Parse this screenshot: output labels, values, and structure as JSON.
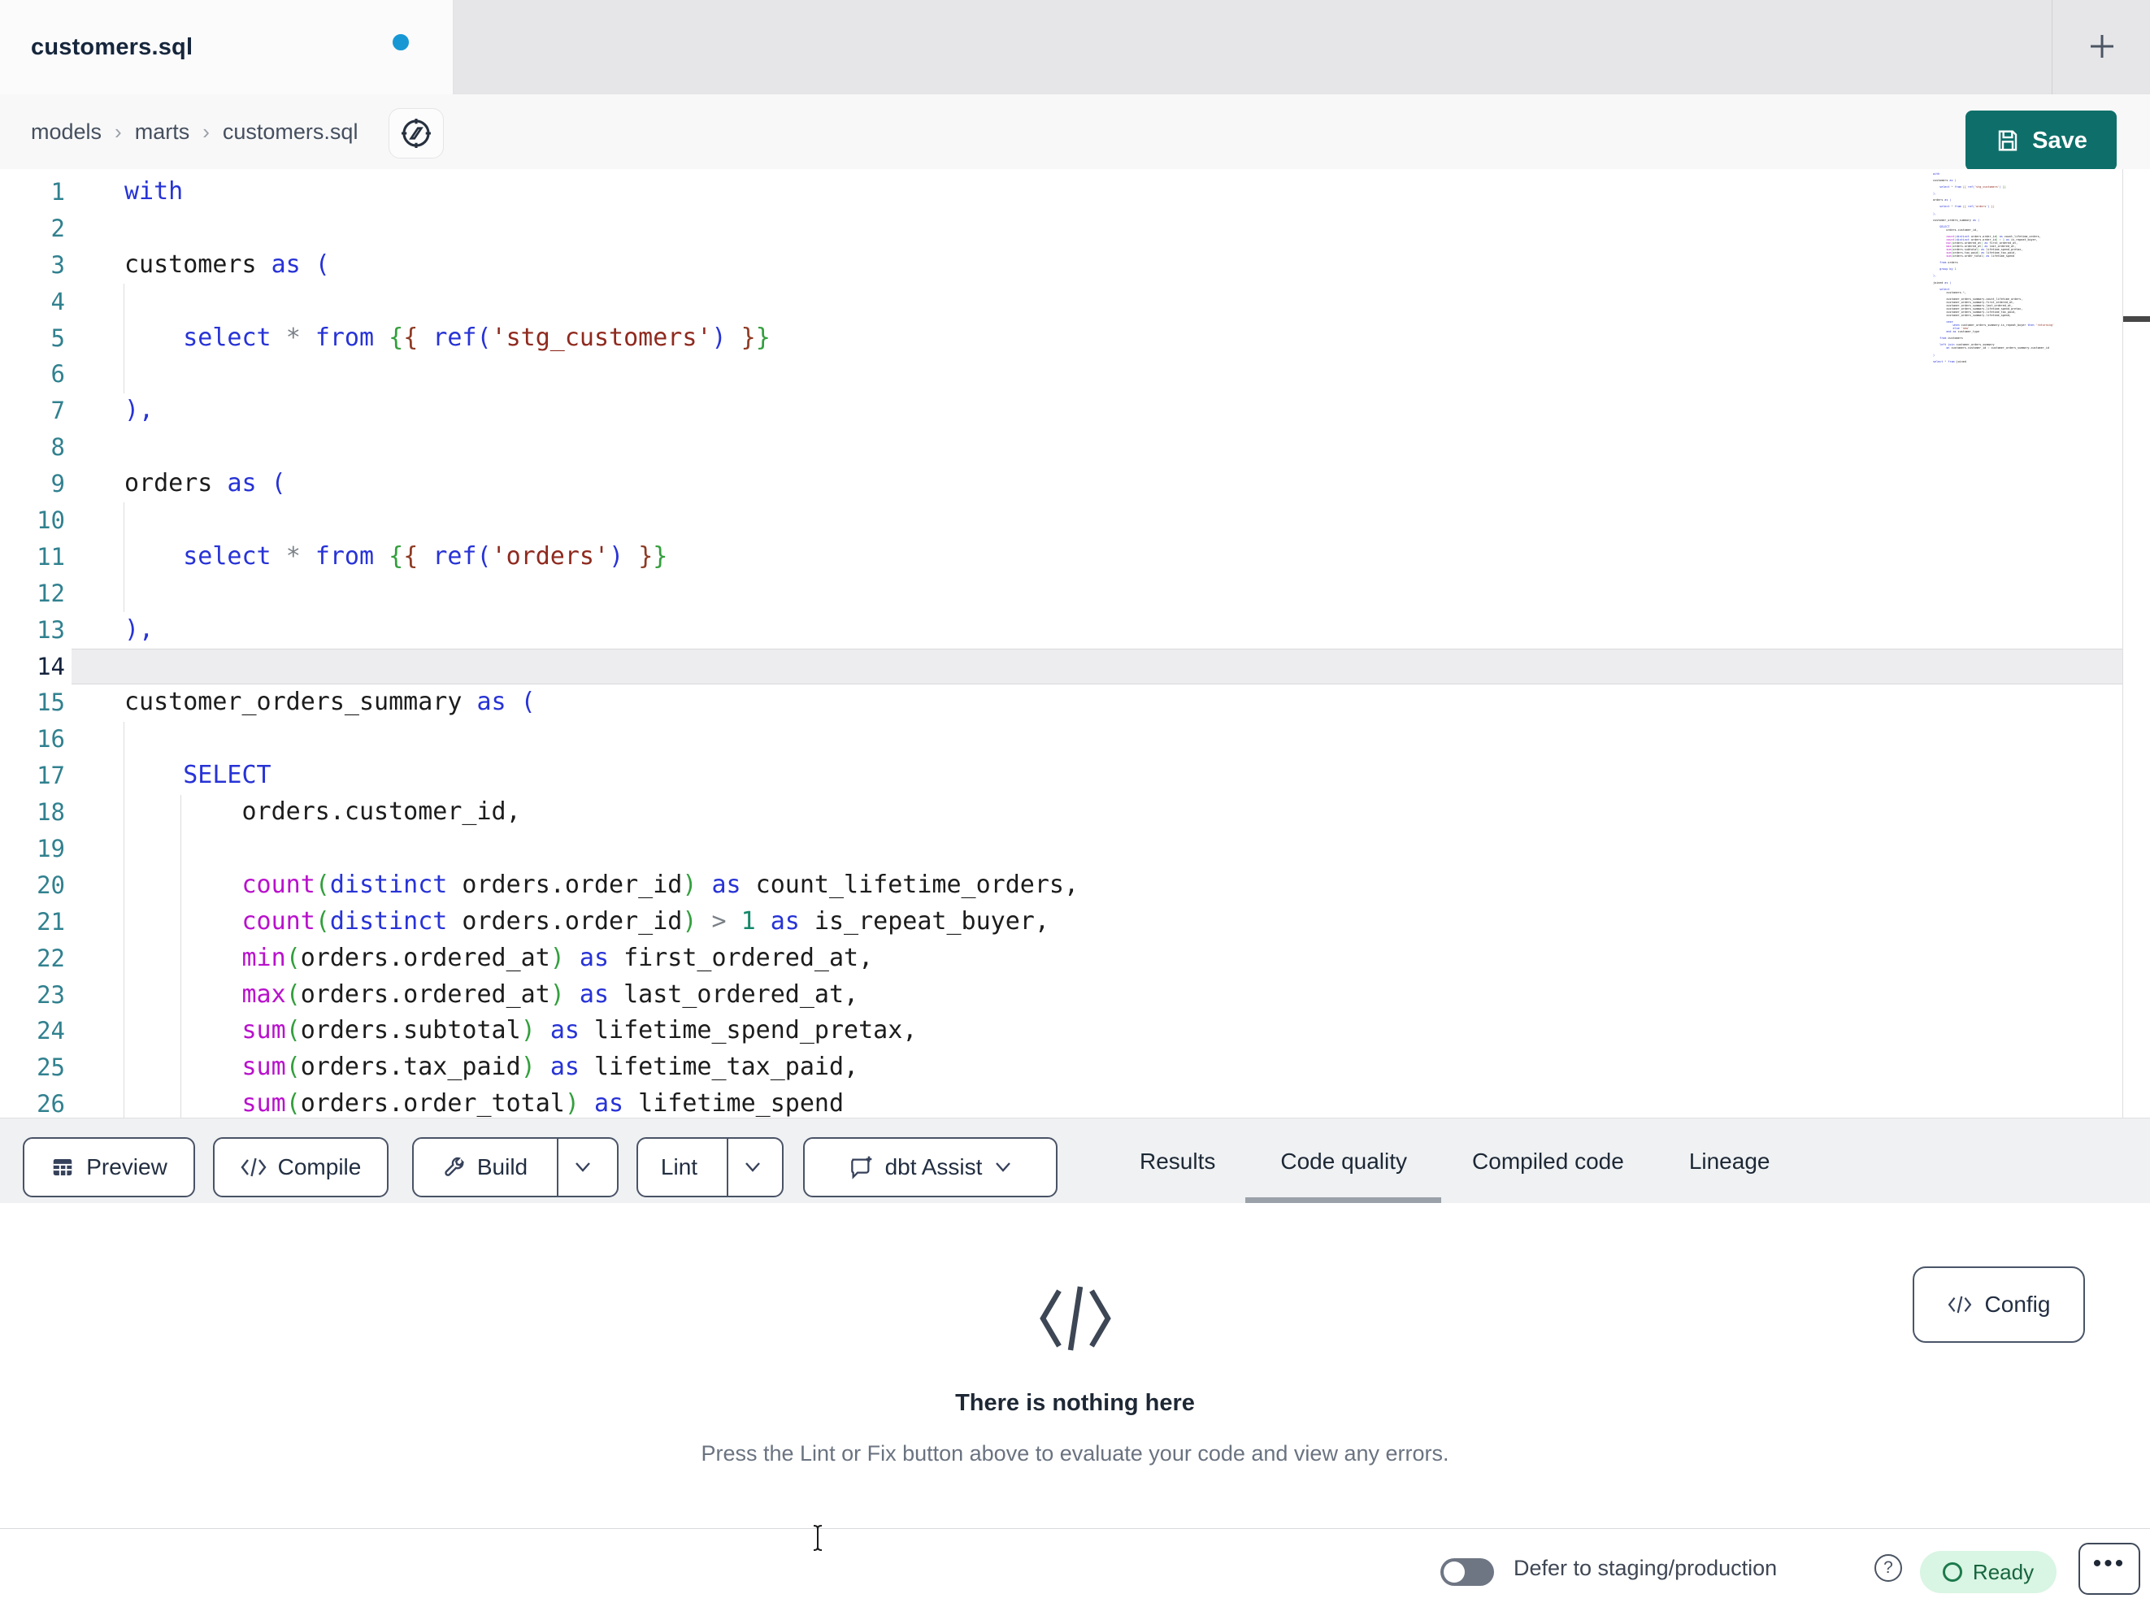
{
  "tab_bar": {
    "tab_title": "customers.sql",
    "unsaved_indicator": "unsaved-changes",
    "new_tab_label": "+"
  },
  "breadcrumb": {
    "items": [
      "models",
      "marts",
      "customers.sql"
    ],
    "separator": "›"
  },
  "save": {
    "label": "Save"
  },
  "toolbar": {
    "preview_label": "Preview",
    "compile_label": "Compile",
    "build_label": "Build",
    "lint_label": "Lint",
    "assist_label": "dbt Assist"
  },
  "tabs": {
    "items": [
      "Results",
      "Code quality",
      "Compiled code",
      "Lineage"
    ],
    "active": "Code quality"
  },
  "panel": {
    "config_label": "Config",
    "empty_title": "There is nothing here",
    "empty_subtitle": "Press the Lint or Fix button above to evaluate your code and view any errors."
  },
  "status_bar": {
    "defer_label": "Defer to staging/production",
    "ready_label": "Ready",
    "more_label": "•••"
  },
  "colors": {
    "accent_save": "#0e6f6a",
    "unsaved_dot": "#1798d5",
    "ready_bg": "#d9f5e3",
    "ready_green": "#1d7a4d",
    "active_tab_underline": "#9ba1a8",
    "line_number": "#31818f",
    "active_line_number": "#15233d",
    "syntax": {
      "k": "#2733d6",
      "f": "#b911cc",
      "s": "#8f2a1f",
      "g": "#339f3d",
      "b": "#8e3b24",
      "n": "#15876a",
      "o": "#7a8087",
      "t": "#1c1c1c"
    }
  },
  "editor": {
    "active_line": 14,
    "lines": [
      {
        "n": 1,
        "t": [
          [
            "k",
            "with"
          ]
        ]
      },
      {
        "n": 2,
        "t": []
      },
      {
        "n": 3,
        "t": [
          [
            "t",
            "customers "
          ],
          [
            "k",
            "as ("
          ]
        ]
      },
      {
        "n": 4,
        "t": []
      },
      {
        "n": 5,
        "t": [
          [
            "t",
            "    "
          ],
          [
            "k",
            "select"
          ],
          [
            "t",
            " "
          ],
          [
            "o",
            "*"
          ],
          [
            "t",
            " "
          ],
          [
            "k",
            "from"
          ],
          [
            "t",
            " "
          ],
          [
            "g",
            "{"
          ],
          [
            "b",
            "{"
          ],
          [
            "t",
            " "
          ],
          [
            "k",
            "ref("
          ],
          [
            "s",
            "'stg_customers'"
          ],
          [
            "k",
            ")"
          ],
          [
            "t",
            " "
          ],
          [
            "b",
            "}"
          ],
          [
            "g",
            "}"
          ]
        ]
      },
      {
        "n": 6,
        "t": []
      },
      {
        "n": 7,
        "t": [
          [
            "k",
            "),"
          ]
        ]
      },
      {
        "n": 8,
        "t": []
      },
      {
        "n": 9,
        "t": [
          [
            "t",
            "orders "
          ],
          [
            "k",
            "as ("
          ]
        ]
      },
      {
        "n": 10,
        "t": []
      },
      {
        "n": 11,
        "t": [
          [
            "t",
            "    "
          ],
          [
            "k",
            "select"
          ],
          [
            "t",
            " "
          ],
          [
            "o",
            "*"
          ],
          [
            "t",
            " "
          ],
          [
            "k",
            "from"
          ],
          [
            "t",
            " "
          ],
          [
            "g",
            "{"
          ],
          [
            "b",
            "{"
          ],
          [
            "t",
            " "
          ],
          [
            "k",
            "ref("
          ],
          [
            "s",
            "'orders'"
          ],
          [
            "k",
            ")"
          ],
          [
            "t",
            " "
          ],
          [
            "b",
            "}"
          ],
          [
            "g",
            "}"
          ]
        ]
      },
      {
        "n": 12,
        "t": []
      },
      {
        "n": 13,
        "t": [
          [
            "k",
            "),"
          ]
        ]
      },
      {
        "n": 14,
        "t": []
      },
      {
        "n": 15,
        "t": [
          [
            "t",
            "customer_orders_summary "
          ],
          [
            "k",
            "as ("
          ]
        ]
      },
      {
        "n": 16,
        "t": []
      },
      {
        "n": 17,
        "t": [
          [
            "t",
            "    "
          ],
          [
            "k",
            "SELECT"
          ]
        ]
      },
      {
        "n": 18,
        "t": [
          [
            "t",
            "        orders.customer_id,"
          ]
        ]
      },
      {
        "n": 19,
        "t": []
      },
      {
        "n": 20,
        "t": [
          [
            "t",
            "        "
          ],
          [
            "f",
            "count"
          ],
          [
            "g",
            "("
          ],
          [
            "k",
            "distinct"
          ],
          [
            "t",
            " orders.order_id"
          ],
          [
            "g",
            ")"
          ],
          [
            "t",
            " "
          ],
          [
            "k",
            "as"
          ],
          [
            "t",
            " count_lifetime_orders,"
          ]
        ]
      },
      {
        "n": 21,
        "t": [
          [
            "t",
            "        "
          ],
          [
            "f",
            "count"
          ],
          [
            "g",
            "("
          ],
          [
            "k",
            "distinct"
          ],
          [
            "t",
            " orders.order_id"
          ],
          [
            "g",
            ")"
          ],
          [
            "t",
            " "
          ],
          [
            "o",
            ">"
          ],
          [
            "t",
            " "
          ],
          [
            "n",
            "1"
          ],
          [
            "t",
            " "
          ],
          [
            "k",
            "as"
          ],
          [
            "t",
            " is_repeat_buyer,"
          ]
        ]
      },
      {
        "n": 22,
        "t": [
          [
            "t",
            "        "
          ],
          [
            "f",
            "min"
          ],
          [
            "g",
            "("
          ],
          [
            "t",
            "orders.ordered_at"
          ],
          [
            "g",
            ")"
          ],
          [
            "t",
            " "
          ],
          [
            "k",
            "as"
          ],
          [
            "t",
            " first_ordered_at,"
          ]
        ]
      },
      {
        "n": 23,
        "t": [
          [
            "t",
            "        "
          ],
          [
            "f",
            "max"
          ],
          [
            "g",
            "("
          ],
          [
            "t",
            "orders.ordered_at"
          ],
          [
            "g",
            ")"
          ],
          [
            "t",
            " "
          ],
          [
            "k",
            "as"
          ],
          [
            "t",
            " last_ordered_at,"
          ]
        ]
      },
      {
        "n": 24,
        "t": [
          [
            "t",
            "        "
          ],
          [
            "f",
            "sum"
          ],
          [
            "g",
            "("
          ],
          [
            "t",
            "orders.subtotal"
          ],
          [
            "g",
            ")"
          ],
          [
            "t",
            " "
          ],
          [
            "k",
            "as"
          ],
          [
            "t",
            " lifetime_spend_pretax,"
          ]
        ]
      },
      {
        "n": 25,
        "t": [
          [
            "t",
            "        "
          ],
          [
            "f",
            "sum"
          ],
          [
            "g",
            "("
          ],
          [
            "t",
            "orders.tax_paid"
          ],
          [
            "g",
            ")"
          ],
          [
            "t",
            " "
          ],
          [
            "k",
            "as"
          ],
          [
            "t",
            " lifetime_tax_paid,"
          ]
        ]
      },
      {
        "n": 26,
        "t": [
          [
            "t",
            "        "
          ],
          [
            "f",
            "sum"
          ],
          [
            "g",
            "("
          ],
          [
            "t",
            "orders.order_total"
          ],
          [
            "g",
            ")"
          ],
          [
            "t",
            " "
          ],
          [
            "k",
            "as"
          ],
          [
            "t",
            " lifetime_spend"
          ]
        ]
      }
    ],
    "minimap_extra_lines": [
      {
        "t": []
      },
      {
        "t": [
          [
            "t",
            "    "
          ],
          [
            "k",
            "from"
          ],
          [
            "t",
            " orders"
          ]
        ]
      },
      {
        "t": []
      },
      {
        "t": [
          [
            "t",
            "    "
          ],
          [
            "k",
            "group by"
          ],
          [
            "t",
            " "
          ],
          [
            "n",
            "1"
          ]
        ]
      },
      {
        "t": []
      },
      {
        "t": [
          [
            "k",
            "),"
          ]
        ]
      },
      {
        "t": []
      },
      {
        "t": [
          [
            "t",
            "joined "
          ],
          [
            "k",
            "as ("
          ]
        ]
      },
      {
        "t": []
      },
      {
        "t": [
          [
            "t",
            "    "
          ],
          [
            "k",
            "select"
          ]
        ]
      },
      {
        "t": [
          [
            "t",
            "        customers."
          ],
          [
            "o",
            "*"
          ],
          [
            "t",
            ","
          ]
        ]
      },
      {
        "t": []
      },
      {
        "t": [
          [
            "t",
            "        customer_orders_summary.count_lifetime_orders,"
          ]
        ]
      },
      {
        "t": [
          [
            "t",
            "        customer_orders_summary.first_ordered_at,"
          ]
        ]
      },
      {
        "t": [
          [
            "t",
            "        customer_orders_summary.last_ordered_at,"
          ]
        ]
      },
      {
        "t": [
          [
            "t",
            "        customer_orders_summary.lifetime_spend_pretax,"
          ]
        ]
      },
      {
        "t": [
          [
            "t",
            "        customer_orders_summary.lifetime_tax_paid,"
          ]
        ]
      },
      {
        "t": [
          [
            "t",
            "        customer_orders_summary.lifetime_spend,"
          ]
        ]
      },
      {
        "t": []
      },
      {
        "t": [
          [
            "t",
            "        "
          ],
          [
            "k",
            "case"
          ]
        ]
      },
      {
        "t": [
          [
            "t",
            "            "
          ],
          [
            "k",
            "when"
          ],
          [
            "t",
            " customer_orders_summary.is_repeat_buyer "
          ],
          [
            "k",
            "then"
          ],
          [
            "t",
            " "
          ],
          [
            "s",
            "'returning'"
          ]
        ]
      },
      {
        "t": [
          [
            "t",
            "            "
          ],
          [
            "k",
            "else"
          ],
          [
            "t",
            " "
          ],
          [
            "s",
            "'new'"
          ]
        ]
      },
      {
        "t": [
          [
            "t",
            "        "
          ],
          [
            "k",
            "end"
          ],
          [
            "t",
            " "
          ],
          [
            "k",
            "as"
          ],
          [
            "t",
            " customer_type"
          ]
        ]
      },
      {
        "t": []
      },
      {
        "t": [
          [
            "t",
            "    "
          ],
          [
            "k",
            "from"
          ],
          [
            "t",
            " customers"
          ]
        ]
      },
      {
        "t": []
      },
      {
        "t": [
          [
            "t",
            "    "
          ],
          [
            "k",
            "left join"
          ],
          [
            "t",
            " customer_orders_summary"
          ]
        ]
      },
      {
        "t": [
          [
            "t",
            "        "
          ],
          [
            "k",
            "on"
          ],
          [
            "t",
            " customers.customer_id "
          ],
          [
            "o",
            "="
          ],
          [
            "t",
            " customer_orders_summary.customer_id"
          ]
        ]
      },
      {
        "t": []
      },
      {
        "t": [
          [
            "k",
            ")"
          ]
        ]
      },
      {
        "t": []
      },
      {
        "t": [
          [
            "k",
            "select"
          ],
          [
            "t",
            " "
          ],
          [
            "o",
            "*"
          ],
          [
            "t",
            " "
          ],
          [
            "k",
            "from"
          ],
          [
            "t",
            " joined"
          ]
        ]
      }
    ]
  }
}
